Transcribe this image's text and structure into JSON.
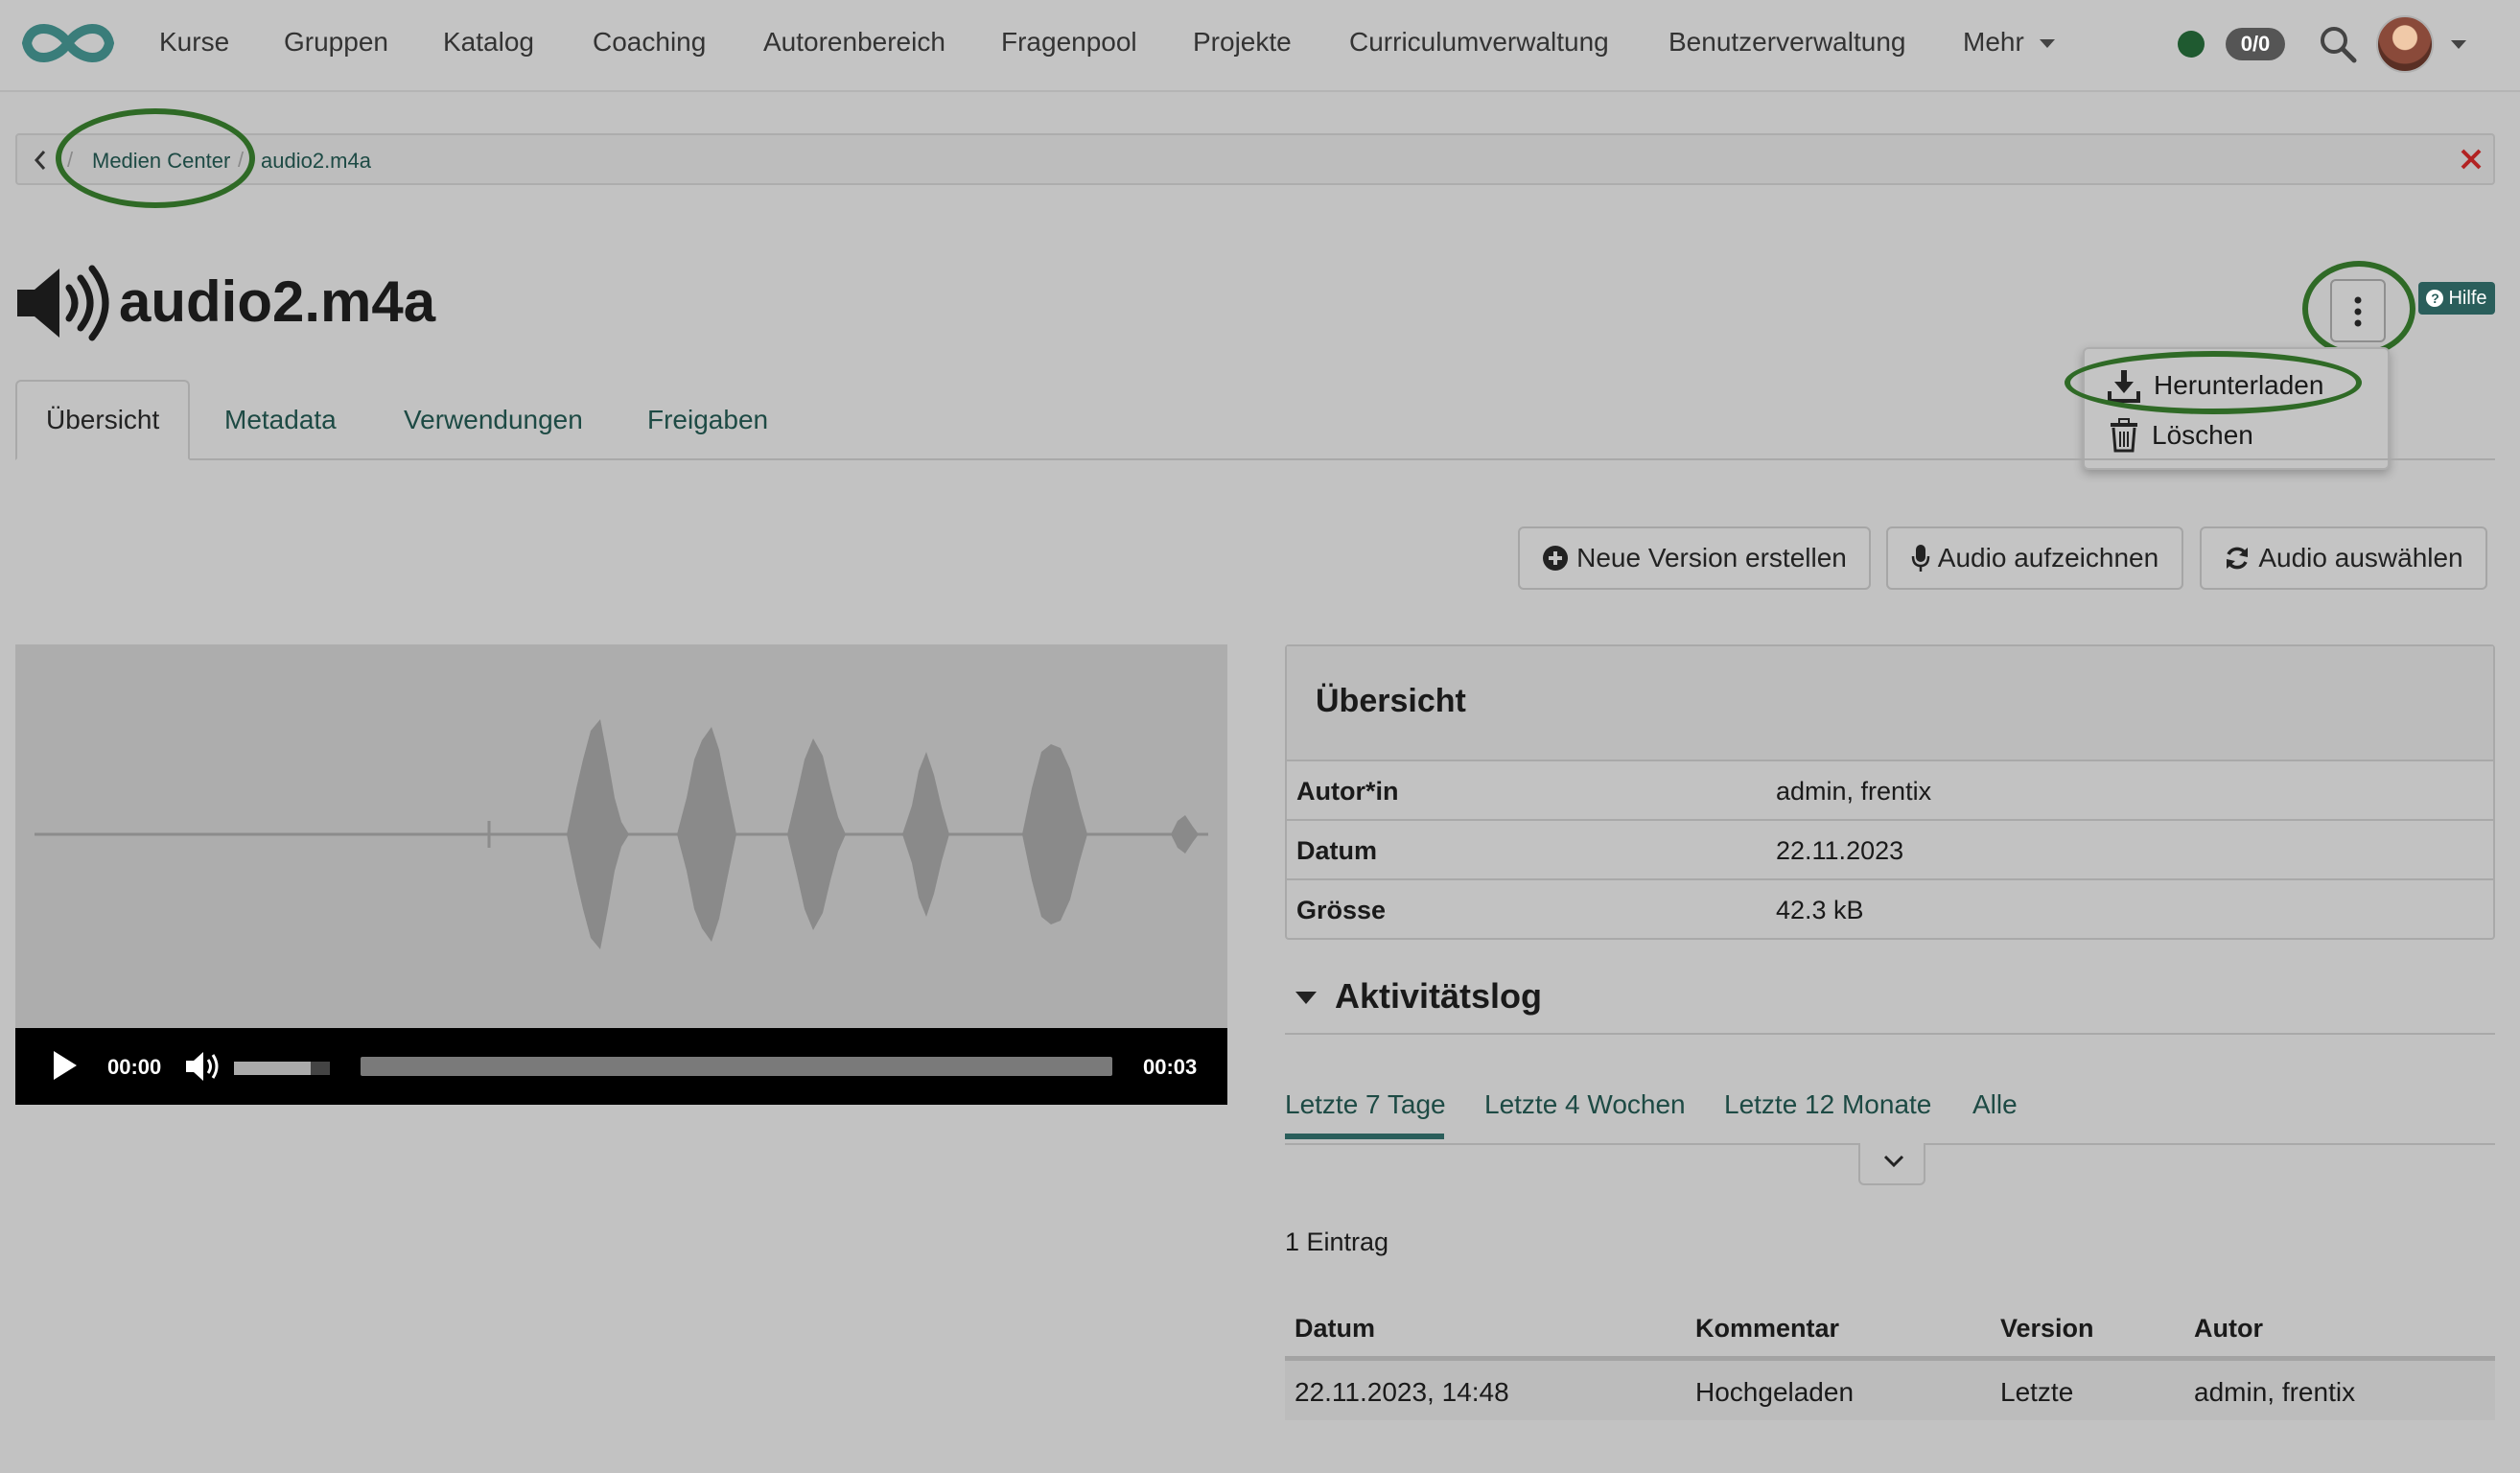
{
  "nav": {
    "items": [
      "Kurse",
      "Gruppen",
      "Katalog",
      "Coaching",
      "Autorenbereich",
      "Fragenpool",
      "Projekte",
      "Curriculumverwaltung",
      "Benutzerverwaltung"
    ],
    "more_label": "Mehr",
    "status_badge": "0/0"
  },
  "breadcrumb": {
    "items": [
      "Medien Center",
      "audio2.m4a"
    ]
  },
  "page": {
    "title": "audio2.m4a",
    "help_label": "Hilfe"
  },
  "menu": {
    "items": [
      "Herunterladen",
      "Löschen"
    ]
  },
  "tabs": [
    "Übersicht",
    "Metadata",
    "Verwendungen",
    "Freigaben"
  ],
  "actions": {
    "new_version": "Neue Version erstellen",
    "record_audio": "Audio aufzeichnen",
    "select_audio": "Audio auswählen"
  },
  "player": {
    "current_time": "00:00",
    "duration": "00:03",
    "volume_level": 0.8
  },
  "overview": {
    "title": "Übersicht",
    "rows": [
      {
        "label": "Autor*in",
        "value": "admin, frentix"
      },
      {
        "label": "Datum",
        "value": "22.11.2023"
      },
      {
        "label": "Grösse",
        "value": "42.3 kB"
      }
    ]
  },
  "activity": {
    "title": "Aktivitätslog",
    "filters": [
      "Letzte 7 Tage",
      "Letzte 4 Wochen",
      "Letzte 12 Monate",
      "Alle"
    ],
    "count_text": "1 Eintrag",
    "columns": [
      "Datum",
      "Kommentar",
      "Version",
      "Autor"
    ],
    "rows": [
      [
        "22.11.2023, 14:48",
        "Hochgeladen",
        "Letzte",
        "admin, frentix"
      ]
    ]
  },
  "colors": {
    "brand": "#3a7d7a",
    "accent_ring": "#2f6a26",
    "link": "#1d4a44",
    "status_online": "#1f5a30",
    "close": "#b22222"
  }
}
